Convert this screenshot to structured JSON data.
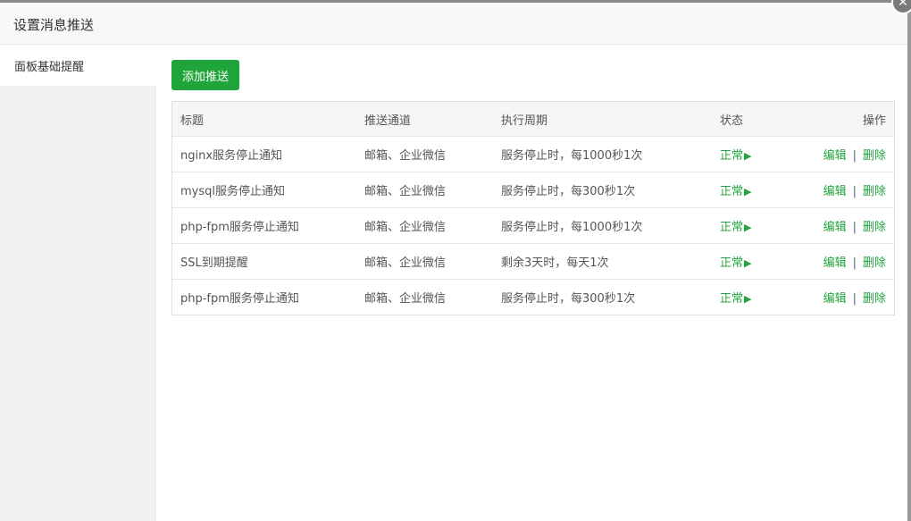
{
  "dialog": {
    "title": "设置消息推送",
    "close_icon": "close-icon"
  },
  "sidebar": {
    "items": [
      {
        "label": "面板基础提醒",
        "active": true
      }
    ]
  },
  "toolbar": {
    "add_label": "添加推送"
  },
  "table": {
    "headers": [
      "标题",
      "推送通道",
      "执行周期",
      "状态",
      "操作"
    ],
    "rows": [
      {
        "title": "nginx服务停止通知",
        "channel": "邮箱、企业微信",
        "period": "服务停止时，每1000秒1次",
        "status": "正常",
        "edit": "编辑",
        "sep": "|",
        "delete": "删除"
      },
      {
        "title": "mysql服务停止通知",
        "channel": "邮箱、企业微信",
        "period": "服务停止时，每300秒1次",
        "status": "正常",
        "edit": "编辑",
        "sep": "|",
        "delete": "删除"
      },
      {
        "title": "php-fpm服务停止通知",
        "channel": "邮箱、企业微信",
        "period": "服务停止时，每1000秒1次",
        "status": "正常",
        "edit": "编辑",
        "sep": "|",
        "delete": "删除"
      },
      {
        "title": "SSL到期提醒",
        "channel": "邮箱、企业微信",
        "period": "剩余3天时，每天1次",
        "status": "正常",
        "edit": "编辑",
        "sep": "|",
        "delete": "删除"
      },
      {
        "title": "php-fpm服务停止通知",
        "channel": "邮箱、企业微信",
        "period": "服务停止时，每300秒1次",
        "status": "正常",
        "edit": "编辑",
        "sep": "|",
        "delete": "删除"
      }
    ]
  },
  "colors": {
    "accent": "#20a53a",
    "header_bg": "#f8f8f8",
    "sidebar_bg": "#f0f0f0"
  }
}
